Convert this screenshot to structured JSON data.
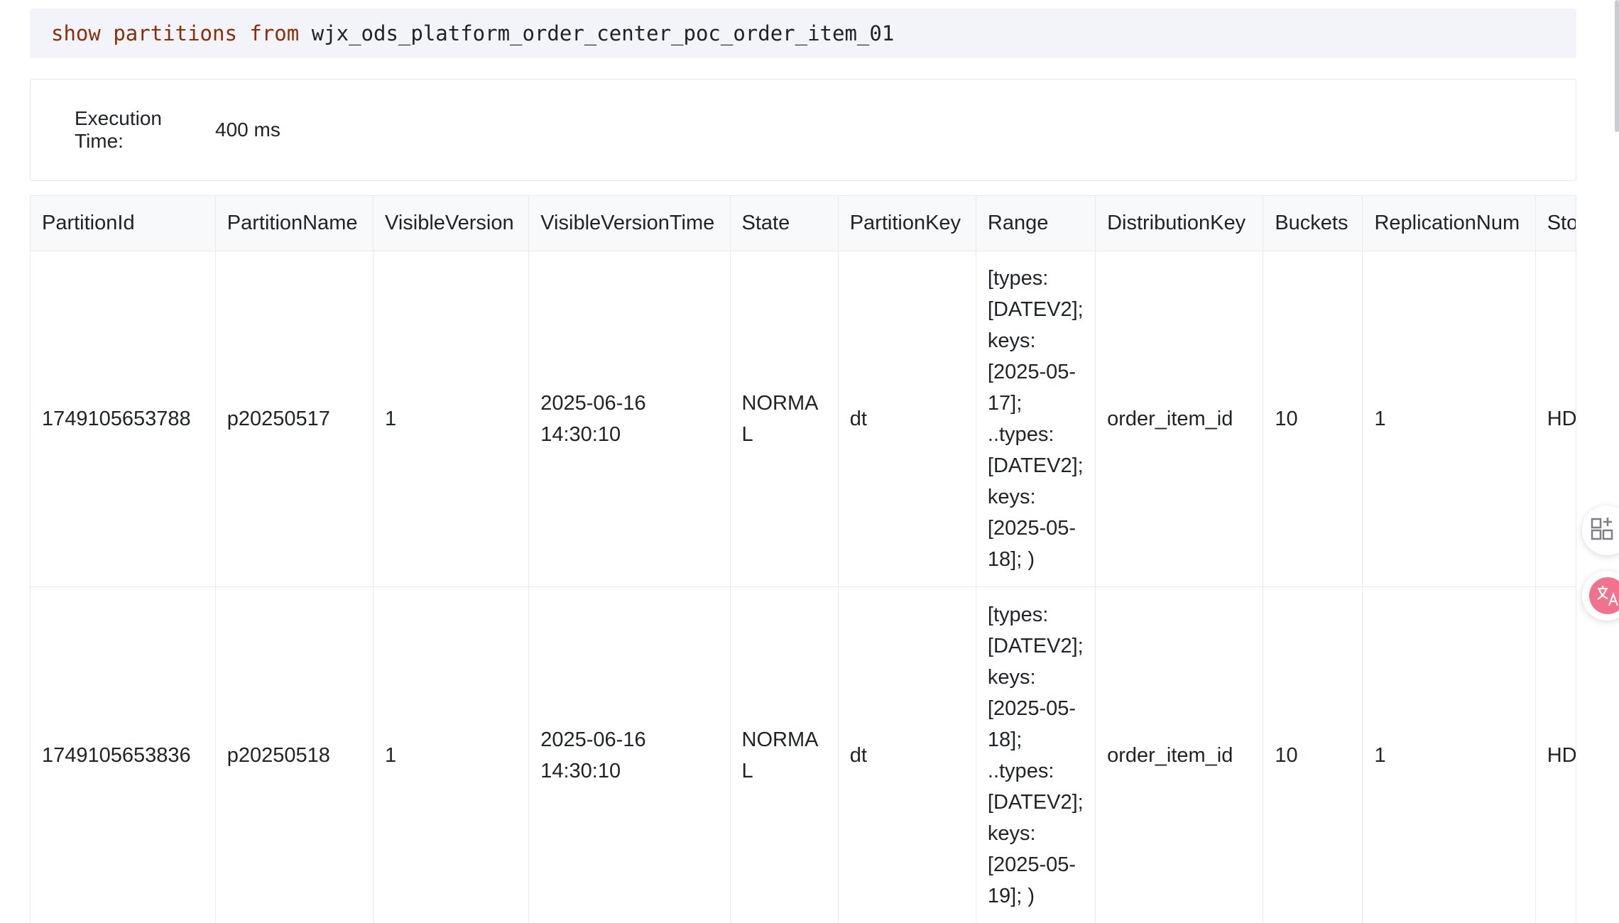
{
  "query": {
    "kw_show": "show",
    "kw_partitions": "partitions",
    "kw_from": "from",
    "table_name": "wjx_ods_platform_order_center_poc_order_item_01"
  },
  "exec": {
    "label": "Execution Time:",
    "value": "400 ms"
  },
  "table": {
    "columns": [
      "PartitionId",
      "PartitionName",
      "VisibleVersion",
      "VisibleVersionTime",
      "State",
      "PartitionKey",
      "Range",
      "DistributionKey",
      "Buckets",
      "ReplicationNum",
      "StorageMedium"
    ],
    "rows": [
      [
        "1749105653788",
        "p20250517",
        "1",
        "2025-06-16 14:30:10",
        "NORMAL",
        "dt",
        "[types: [DATEV2]; keys: [2025-05-17]; ..types: [DATEV2]; keys: [2025-05-18]; )",
        "order_item_id",
        "10",
        "1",
        "HDD"
      ],
      [
        "1749105653836",
        "p20250518",
        "1",
        "2025-06-16 14:30:10",
        "NORMAL",
        "dt",
        "[types: [DATEV2]; keys: [2025-05-18]; ..types: [DATEV2]; keys: [2025-05-19]; )",
        "order_item_id",
        "10",
        "1",
        "HDD"
      ]
    ]
  },
  "widgets": {
    "apps_icon": "apps-add-icon",
    "translate_icon": "translate-icon",
    "translate_color": "#f0728c"
  }
}
